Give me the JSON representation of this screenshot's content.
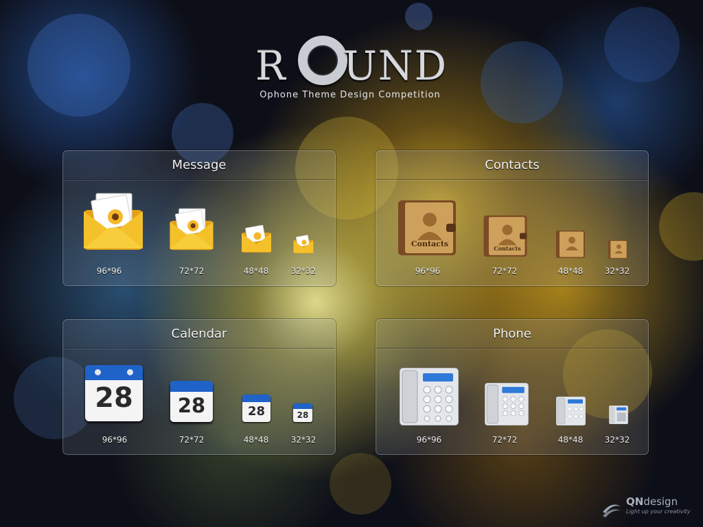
{
  "logo": {
    "text_start": "R",
    "text_end": "UND",
    "subtitle": "Ophone Theme Design Competition"
  },
  "panels": [
    {
      "title": "Message",
      "sizes": [
        "96*96",
        "72*72",
        "48*48",
        "32*32"
      ]
    },
    {
      "title": "Contacts",
      "icon_text": "Contacts",
      "sizes": [
        "96*96",
        "72*72",
        "48*48",
        "32*32"
      ]
    },
    {
      "title": "Calendar",
      "icon_day": "28",
      "sizes": [
        "96*96",
        "72*72",
        "48*48",
        "32*32"
      ]
    },
    {
      "title": "Phone",
      "sizes": [
        "96*96",
        "72*72",
        "48*48",
        "32*32"
      ]
    }
  ],
  "footer": {
    "brand_prefix": "QN",
    "brand_suffix": "design",
    "tagline": "Light up your creativity"
  },
  "icons": [
    "envelope-icon",
    "contacts-book-icon",
    "calendar-icon",
    "desk-phone-icon",
    "qn-logo-icon"
  ],
  "colors": {
    "envelope": "#f0b21c",
    "book_cover": "#7a4a24",
    "book_page": "#cda15c",
    "calendar_header": "#1f62c8",
    "phone_body": "#e3e6ea",
    "phone_screen": "#2f79d8"
  }
}
